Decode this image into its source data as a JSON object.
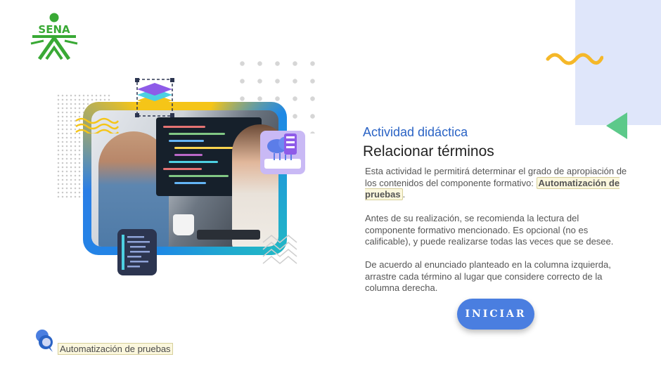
{
  "brand": {
    "logo_text": "SENA",
    "color": "#39a935"
  },
  "activity": {
    "label": "Actividad didáctica",
    "title": "Relacionar términos"
  },
  "description": {
    "p1_before": "Esta actividad le permitirá determinar el grado de apropiación de los contenidos del componente formativo: ",
    "p1_highlight": "Automatización de pruebas",
    "p1_after": ".",
    "p2": "Antes de su realización, se recomienda la lectura del componente formativo mencionado.  Es opcional (no es calificable), y puede realizarse todas las veces que se desee.",
    "p3": "De acuerdo al enunciado planteado en la columna izquierda, arrastre cada término al lugar que considere correcto de la columna derecha."
  },
  "actions": {
    "start_label": "INICIAR"
  },
  "footer": {
    "component_name": "Automatización de pruebas"
  },
  "icons": {
    "logo": "sena-logo-icon",
    "footer": "chat-bubbles-icon",
    "layers": "layers-stack-icon",
    "cloud": "cloud-server-icon",
    "code": "code-card-icon"
  },
  "colors": {
    "accent_blue": "#2a63c5",
    "button_blue": "#4a7ee0",
    "green": "#5cc98a",
    "yellow": "#f5c518",
    "panel": "#dfe6fa"
  }
}
